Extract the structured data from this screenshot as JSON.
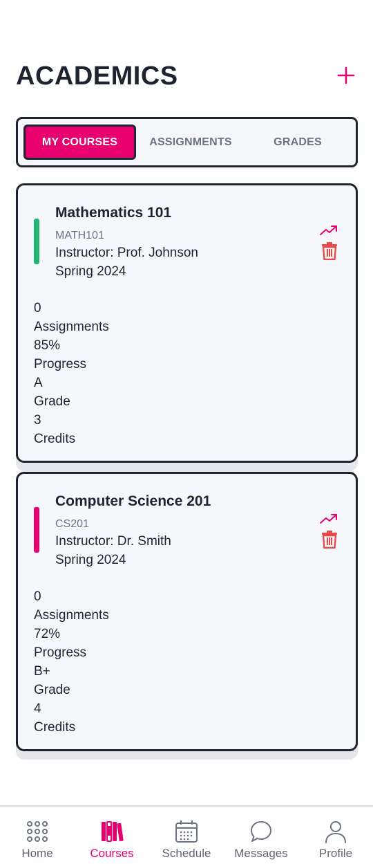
{
  "header": {
    "title": "ACADEMICS",
    "add_icon": "plus-icon"
  },
  "tabs": [
    {
      "label": "MY COURSES",
      "active": true
    },
    {
      "label": "ASSIGNMENTS",
      "active": false
    },
    {
      "label": "GRADES",
      "active": false
    }
  ],
  "courses": [
    {
      "name": "Mathematics 101",
      "code": "MATH101",
      "instructor": "Instructor: Prof. Johnson",
      "term": "Spring 2024",
      "accent_color": "#22b573",
      "assignments_value": "0",
      "assignments_label": "Assignments",
      "progress_value": "85%",
      "progress_label": "Progress",
      "grade_value": "A",
      "grade_label": "Grade",
      "credits_value": "3",
      "credits_label": "Credits"
    },
    {
      "name": "Computer Science 201",
      "code": "CS201",
      "instructor": "Instructor: Dr. Smith",
      "term": "Spring 2024",
      "accent_color": "#e8006f",
      "assignments_value": "0",
      "assignments_label": "Assignments",
      "progress_value": "72%",
      "progress_label": "Progress",
      "grade_value": "B+",
      "grade_label": "Grade",
      "credits_value": "4",
      "credits_label": "Credits"
    }
  ],
  "nav": [
    {
      "label": "Home",
      "icon": "grid-dots-icon",
      "active": false
    },
    {
      "label": "Courses",
      "icon": "books-icon",
      "active": true
    },
    {
      "label": "Schedule",
      "icon": "calendar-icon",
      "active": false
    },
    {
      "label": "Messages",
      "icon": "chat-bubble-icon",
      "active": false
    },
    {
      "label": "Profile",
      "icon": "person-icon",
      "active": false
    }
  ],
  "colors": {
    "accent": "#e8006f",
    "danger": "#e84a4a",
    "ink": "#1e2330",
    "muted": "#6b7280"
  }
}
